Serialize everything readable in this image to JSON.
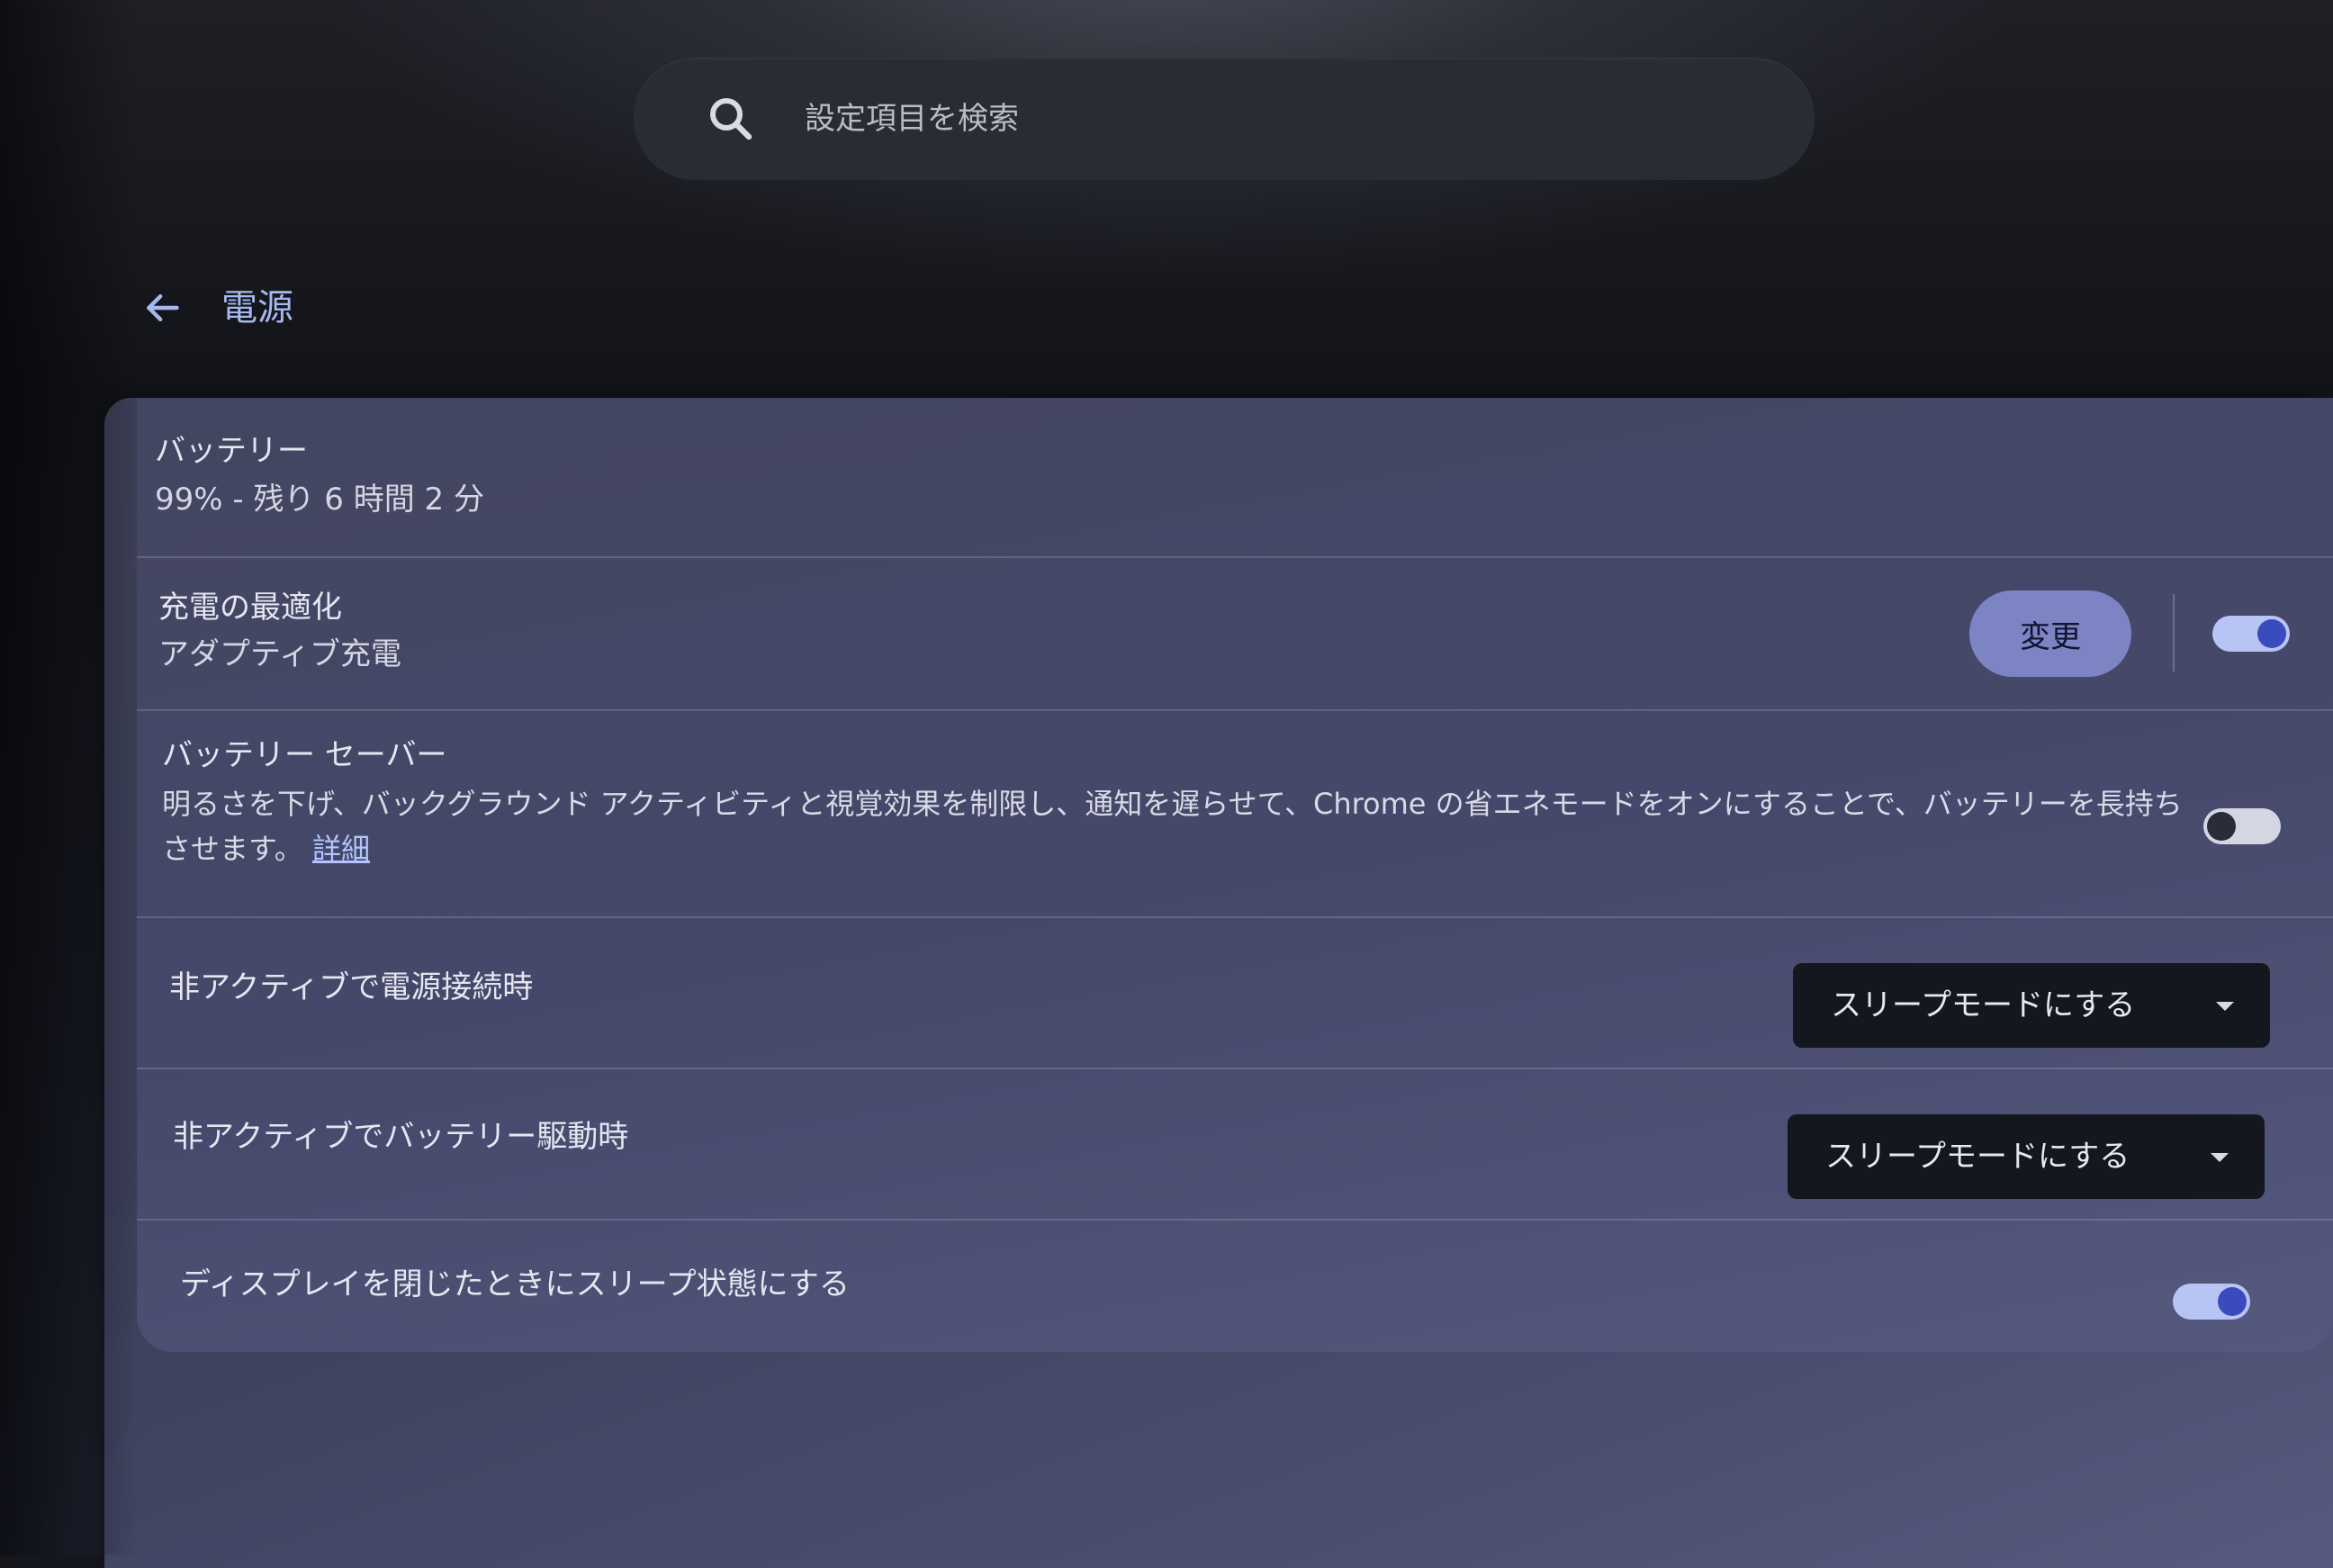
{
  "search": {
    "placeholder": "設定項目を検索"
  },
  "header": {
    "title": "電源"
  },
  "battery": {
    "title": "バッテリー",
    "status": "99% - 残り 6 時間 2 分"
  },
  "charge_optimization": {
    "title": "充電の最適化",
    "subtitle": "アダプティブ充電",
    "change_label": "変更",
    "toggle_on": true
  },
  "battery_saver": {
    "title": "バッテリー セーバー",
    "description": "明るさを下げ、バックグラウンド アクティビティと視覚効果を制限し、通知を遅らせて、Chrome の省エネモードをオンにすることで、バッテリーを長持ちさせます。",
    "learn_more": "詳細",
    "toggle_on": false
  },
  "idle_plugged": {
    "title": "非アクティブで電源接続時",
    "selected": "スリープモードにする"
  },
  "idle_battery": {
    "title": "非アクティブでバッテリー駆動時",
    "selected": "スリープモードにする"
  },
  "lid_sleep": {
    "title": "ディスプレイを閉じたときにスリープ状態にする",
    "toggle_on": true
  },
  "colors": {
    "accent": "#a8b8f0",
    "button": "#7c84c4",
    "toggle_on_track": "#b8c4f4",
    "toggle_on_knob": "#3a4bbd"
  }
}
